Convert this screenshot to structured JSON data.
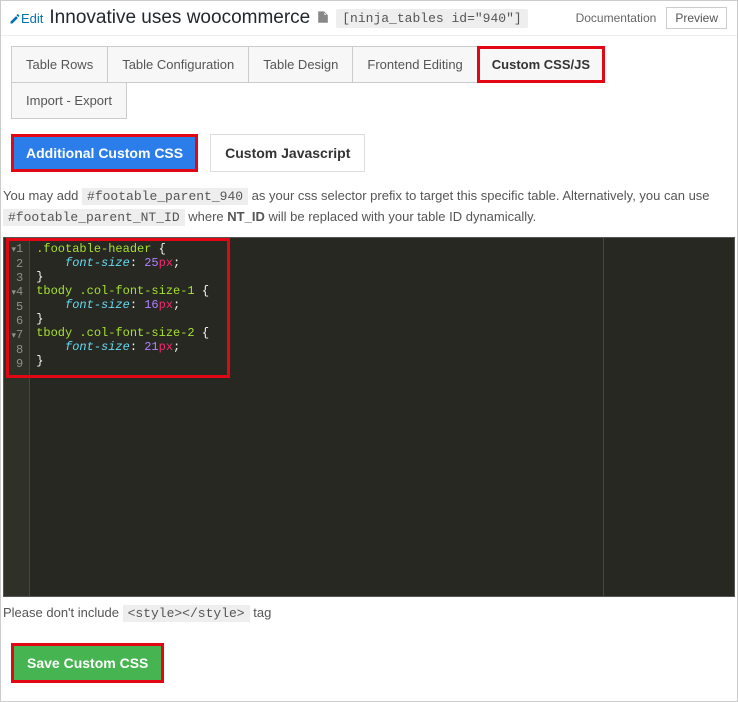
{
  "header": {
    "edit_label": "Edit",
    "title": "Innovative uses woocommerce",
    "shortcode": "[ninja_tables id=\"940\"]",
    "documentation_label": "Documentation",
    "preview_label": "Preview"
  },
  "tabs": {
    "items": [
      {
        "label": "Table Rows"
      },
      {
        "label": "Table Configuration"
      },
      {
        "label": "Table Design"
      },
      {
        "label": "Frontend Editing"
      },
      {
        "label": "Custom CSS/JS"
      }
    ],
    "second_row": [
      {
        "label": "Import - Export"
      }
    ]
  },
  "subtabs": {
    "items": [
      {
        "label": "Additional Custom CSS",
        "active": true
      },
      {
        "label": "Custom Javascript",
        "active": false
      }
    ]
  },
  "help": {
    "prefix_text": "You may add ",
    "selector_code": "#footable_parent_940",
    "mid_text": " as your css selector prefix to target this specific table. Alternatively, you can use ",
    "dynamic_code": "#footable_parent_NT_ID",
    "suffix_text_1": " where ",
    "nt_id_strong": "NT_ID",
    "suffix_text_2": " will be replaced with your table ID dynamically."
  },
  "editor": {
    "lines": [
      {
        "n": "1",
        "sel": ".footable-header",
        "open": true
      },
      {
        "n": "2",
        "prop": "font-size",
        "num": "25",
        "unit": "px"
      },
      {
        "n": "3",
        "close": true
      },
      {
        "n": "4",
        "sel": "tbody .col-font-size-1",
        "open": true
      },
      {
        "n": "5",
        "prop": "font-size",
        "num": "16",
        "unit": "px"
      },
      {
        "n": "6",
        "close": true
      },
      {
        "n": "7",
        "sel": "tbody .col-font-size-2",
        "open": true
      },
      {
        "n": "8",
        "prop": "font-size",
        "num": "21",
        "unit": "px"
      },
      {
        "n": "9",
        "close": true
      }
    ]
  },
  "exclude_note": {
    "prefix": "Please don't include ",
    "code": "<style></style>",
    "suffix": " tag"
  },
  "save_label": "Save Custom CSS"
}
